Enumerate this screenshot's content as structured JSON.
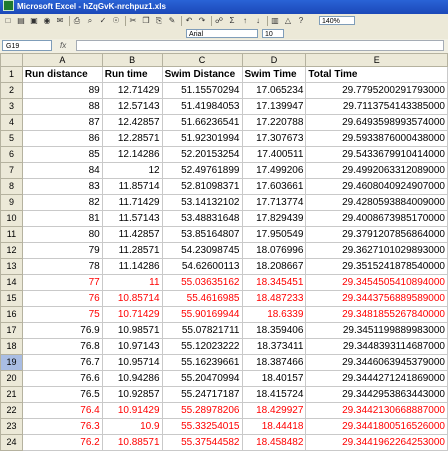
{
  "window": {
    "title": "Microsoft Excel - hZqGvK-nrchpuz1.xls"
  },
  "toolbar": {
    "font_name": "Arial",
    "font_size": "10",
    "zoom": "140%",
    "icons": [
      "new-icon",
      "open-icon",
      "save-icon",
      "permission-icon",
      "email-icon",
      "print-icon",
      "print-preview-icon",
      "spelling-icon",
      "research-icon",
      "cut-icon",
      "copy-icon",
      "paste-icon",
      "format-painter-icon",
      "undo-icon",
      "redo-icon",
      "hyperlink-icon",
      "autosum-icon",
      "sort-asc-icon",
      "sort-desc-icon",
      "chart-wizard-icon",
      "drawing-icon",
      "help-icon"
    ]
  },
  "formula_bar": {
    "name_box": "G19",
    "fx": "fx",
    "value": ""
  },
  "sheet": {
    "columns": [
      "A",
      "B",
      "C",
      "D",
      "E"
    ],
    "selected_row": "19",
    "red_color": "#ff0000",
    "rows": [
      {
        "n": "1",
        "cells": [
          "Run distance",
          "Run time",
          "Swim Distance",
          "Swim Time",
          "Total Time"
        ],
        "header": true
      },
      {
        "n": "2",
        "cells": [
          "89",
          "12.71429",
          "51.15570294",
          "17.065234",
          "29.7795200291793000"
        ]
      },
      {
        "n": "3",
        "cells": [
          "88",
          "12.57143",
          "51.41984053",
          "17.139947",
          "29.7113754143385000"
        ]
      },
      {
        "n": "4",
        "cells": [
          "87",
          "12.42857",
          "51.66236541",
          "17.220788",
          "29.6493598993574000"
        ]
      },
      {
        "n": "5",
        "cells": [
          "86",
          "12.28571",
          "51.92301994",
          "17.307673",
          "29.5933876000438000"
        ]
      },
      {
        "n": "6",
        "cells": [
          "85",
          "12.14286",
          "52.20153254",
          "17.400511",
          "29.5433679910414000"
        ]
      },
      {
        "n": "7",
        "cells": [
          "84",
          "12",
          "52.49761899",
          "17.499206",
          "29.4992063312089000"
        ]
      },
      {
        "n": "8",
        "cells": [
          "83",
          "11.85714",
          "52.81098371",
          "17.603661",
          "29.4608040924907000"
        ]
      },
      {
        "n": "9",
        "cells": [
          "82",
          "11.71429",
          "53.14132102",
          "17.713774",
          "29.4280593884009000"
        ]
      },
      {
        "n": "10",
        "cells": [
          "81",
          "11.57143",
          "53.48831648",
          "17.829439",
          "29.4008673985170000"
        ]
      },
      {
        "n": "11",
        "cells": [
          "80",
          "11.42857",
          "53.85164807",
          "17.950549",
          "29.3791207856864000"
        ]
      },
      {
        "n": "12",
        "cells": [
          "79",
          "11.28571",
          "54.23098745",
          "18.076996",
          "29.3627101029893000"
        ]
      },
      {
        "n": "13",
        "cells": [
          "78",
          "11.14286",
          "54.62600113",
          "18.208667",
          "29.3515241878540000"
        ]
      },
      {
        "n": "14",
        "cells": [
          "77",
          "11",
          "55.03635162",
          "18.345451",
          "29.3454505410894000"
        ],
        "red": true
      },
      {
        "n": "15",
        "cells": [
          "76",
          "10.85714",
          "55.4616985",
          "18.487233",
          "29.3443756889589000"
        ],
        "red": true
      },
      {
        "n": "16",
        "cells": [
          "75",
          "10.71429",
          "55.90169944",
          "18.6339",
          "29.3481855267840000"
        ],
        "red": true
      },
      {
        "n": "17",
        "cells": [
          "76.9",
          "10.98571",
          "55.07821711",
          "18.359406",
          "29.3451199889983000"
        ]
      },
      {
        "n": "18",
        "cells": [
          "76.8",
          "10.97143",
          "55.12023222",
          "18.373411",
          "29.3448393114687000"
        ]
      },
      {
        "n": "19",
        "cells": [
          "76.7",
          "10.95714",
          "55.16239661",
          "18.387466",
          "29.3446063945379000"
        ]
      },
      {
        "n": "20",
        "cells": [
          "76.6",
          "10.94286",
          "55.20470994",
          "18.40157",
          "29.3444271241869000"
        ]
      },
      {
        "n": "21",
        "cells": [
          "76.5",
          "10.92857",
          "55.24717187",
          "18.415724",
          "29.3442953863443000"
        ]
      },
      {
        "n": "22",
        "cells": [
          "76.4",
          "10.91429",
          "55.28978206",
          "18.429927",
          "29.3442130668887000"
        ],
        "red": true
      },
      {
        "n": "23",
        "cells": [
          "76.3",
          "10.9",
          "55.33254015",
          "18.44418",
          "29.3441800516526000"
        ],
        "red": true
      },
      {
        "n": "24",
        "cells": [
          "76.2",
          "10.88571",
          "55.37544582",
          "18.458482",
          "29.3441962264253000"
        ],
        "red": true
      }
    ]
  }
}
